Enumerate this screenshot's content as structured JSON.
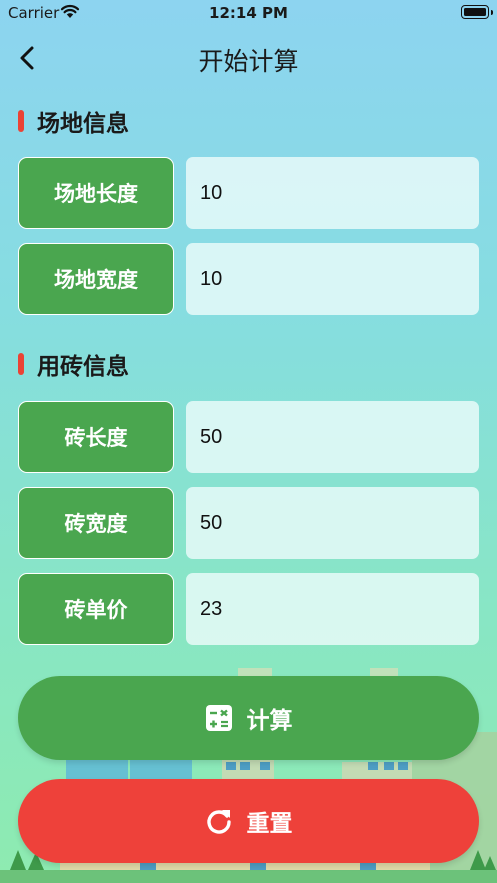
{
  "status_bar": {
    "carrier": "Carrier",
    "time": "12:14 PM"
  },
  "nav": {
    "title": "开始计算"
  },
  "site_section": {
    "title": "场地信息",
    "fields": [
      {
        "label": "场地长度",
        "value": "10"
      },
      {
        "label": "场地宽度",
        "value": "10"
      }
    ]
  },
  "brick_section": {
    "title": "用砖信息",
    "fields": [
      {
        "label": "砖长度",
        "value": "50"
      },
      {
        "label": "砖宽度",
        "value": "50"
      },
      {
        "label": "砖单价",
        "value": "23"
      }
    ]
  },
  "actions": {
    "calculate_label": "计算",
    "calculate_icon": "calculator-icon",
    "reset_label": "重置",
    "reset_icon": "refresh-icon"
  },
  "colors": {
    "label_green": "#4aa64f",
    "accent_red": "#ea4335",
    "reset_red": "#ee413a",
    "input_bg": "#e6f8f8"
  }
}
